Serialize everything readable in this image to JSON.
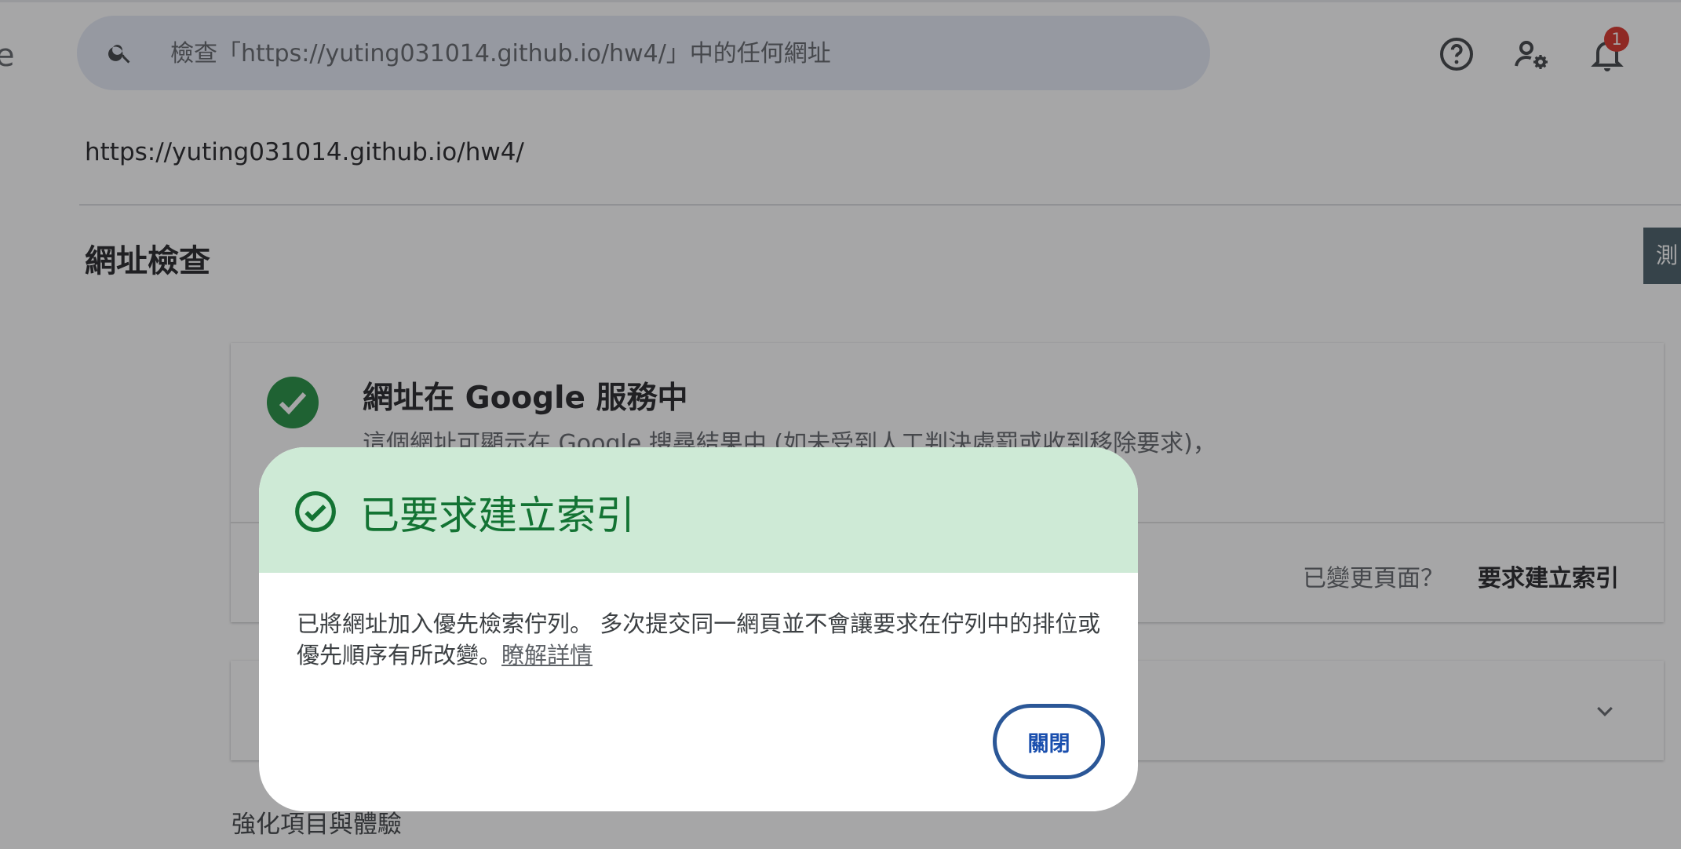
{
  "header": {
    "brand_fragment": "e",
    "search_placeholder": "檢查「https://yuting031014.github.io/hw4/」中的任何網址",
    "notification_count": "1"
  },
  "page": {
    "url": "https://yuting031014.github.io/hw4/",
    "section_title": "網址檢查",
    "side_tab": "測"
  },
  "status_card": {
    "title": "網址在 Google 服務中",
    "description": "這個網址可顯示在 Google 搜尋結果中 (如未受到人工判決處罰或收到移除要求)，",
    "changed_prompt": "已變更頁面？",
    "request_index_label": "要求建立索引"
  },
  "enhancements": {
    "title": "強化項目與體驗"
  },
  "dialog": {
    "title": "已要求建立索引",
    "body": "已將網址加入優先檢索佇列。 多次提交同一網頁並不會讓要求在佇列中的排位或優先順序有所改變。",
    "learn_more": "瞭解詳情",
    "close_label": "關閉"
  },
  "colors": {
    "success_green": "#1e8e3e",
    "dialog_header": "#ceead6",
    "dialog_title": "#137333",
    "search_bg": "#e5e9f6",
    "badge": "#d93025"
  }
}
